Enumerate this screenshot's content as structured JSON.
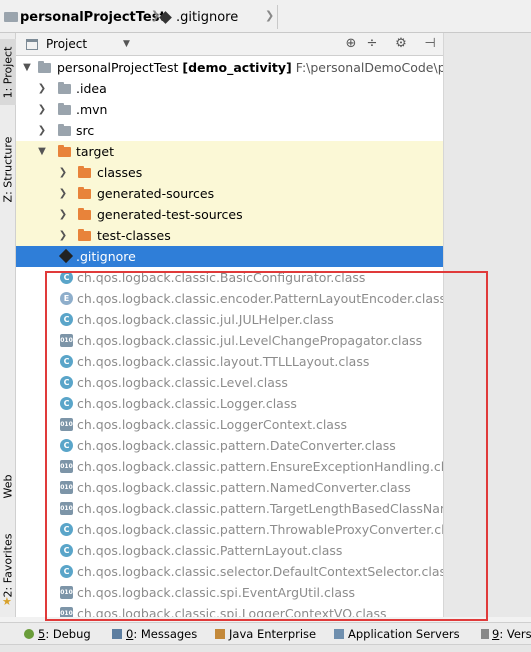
{
  "breadcrumb": {
    "project": "personalProjectTest",
    "file": ".gitignore"
  },
  "panel": {
    "view_label": "Project"
  },
  "left_tabs": {
    "project": "1: Project",
    "structure": "Z: Structure",
    "web": "Web",
    "favorites": "2: Favorites"
  },
  "tree": {
    "root": {
      "name": "personalProjectTest",
      "module": "[demo_activity]",
      "path": "F:\\personalDemoCode\\perso"
    },
    "idea": ".idea",
    "mvn": ".mvn",
    "src": "src",
    "target": "target",
    "classes": "classes",
    "generated_sources": "generated-sources",
    "generated_test_sources": "generated-test-sources",
    "test_classes": "test-classes",
    "gitignore": ".gitignore"
  },
  "classes": [
    "ch.qos.logback.classic.BasicConfigurator.class",
    "ch.qos.logback.classic.encoder.PatternLayoutEncoder.class",
    "ch.qos.logback.classic.jul.JULHelper.class",
    "ch.qos.logback.classic.jul.LevelChangePropagator.class",
    "ch.qos.logback.classic.layout.TTLLLayout.class",
    "ch.qos.logback.classic.Level.class",
    "ch.qos.logback.classic.Logger.class",
    "ch.qos.logback.classic.LoggerContext.class",
    "ch.qos.logback.classic.pattern.DateConverter.class",
    "ch.qos.logback.classic.pattern.EnsureExceptionHandling.class",
    "ch.qos.logback.classic.pattern.NamedConverter.class",
    "ch.qos.logback.classic.pattern.TargetLengthBasedClassNameAb",
    "ch.qos.logback.classic.pattern.ThrowableProxyConverter.class",
    "ch.qos.logback.classic.PatternLayout.class",
    "ch.qos.logback.classic.selector.DefaultContextSelector.class",
    "ch.qos.logback.classic.spi.EventArgUtil.class",
    "ch.qos.logback.classic.spi.LoggerContextVO.class"
  ],
  "class_icons": [
    "c",
    "e",
    "c",
    "bin",
    "c",
    "c",
    "c",
    "bin",
    "c",
    "bin",
    "bin",
    "bin",
    "c",
    "c",
    "c",
    "bin",
    "bin"
  ],
  "bottom_tabs": {
    "debug_num": "5",
    "debug": ": Debug",
    "messages_num": "0",
    "messages": ": Messages",
    "java_ee": "Java Enterprise",
    "app_servers": "Application Servers",
    "version_num": "9",
    "version": ": Versi"
  },
  "colors": {
    "selection": "#2f7ed8",
    "excluded_bg": "#fbf8d6",
    "highlight_box": "#e03a3a"
  }
}
